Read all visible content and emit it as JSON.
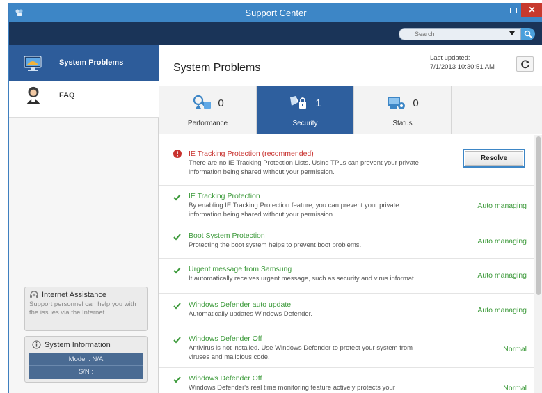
{
  "window": {
    "title": "Support Center"
  },
  "search": {
    "placeholder": "Search"
  },
  "sidebar": {
    "items": [
      {
        "label": "System Problems"
      },
      {
        "label": "FAQ"
      }
    ],
    "internet_assistance": {
      "title": "Internet Assistance",
      "description": "Support personnel can help you with the issues via the Internet."
    },
    "system_information": {
      "title": "System Information",
      "model": "Model : N/A",
      "sn": "S/N :"
    }
  },
  "main": {
    "title": "System Problems",
    "last_updated_label": "Last updated:",
    "last_updated_value": "7/1/2013 10:30:51 AM",
    "tabs": [
      {
        "label": "Performance",
        "count": "0"
      },
      {
        "label": "Security",
        "count": "1"
      },
      {
        "label": "Status",
        "count": "0"
      }
    ],
    "resolve_label": "Resolve",
    "items": [
      {
        "title": "IE Tracking Protection (recommended)",
        "desc": "There are no IE Tracking Protection Lists. Using TPLs can prevent your private information being shared without your permission.",
        "status": ""
      },
      {
        "title": "IE Tracking Protection",
        "desc": "By enabling IE Tracking Protection feature, you can prevent your private information being shared without your permission.",
        "status": "Auto managing"
      },
      {
        "title": "Boot System Protection",
        "desc": "Protecting the boot system helps to prevent boot problems.",
        "status": "Auto managing"
      },
      {
        "title": "Urgent message from Samsung",
        "desc": "It automatically receives urgent message, such as security and virus informat",
        "status": "Auto managing"
      },
      {
        "title": "Windows Defender auto update",
        "desc": "Automatically updates Windows Defender.",
        "status": "Auto managing"
      },
      {
        "title": "Windows Defender Off",
        "desc": "Antivirus is not installed. Use Windows Defender to protect your system from viruses and malicious code.",
        "status": "Normal"
      },
      {
        "title": "Windows Defender Off",
        "desc": "Windows Defender's real time monitoring feature actively protects your",
        "status": "Normal"
      }
    ]
  },
  "colors": {
    "titlebar": "#3d86c6",
    "accent_dark": "#2d5c9a",
    "warning": "#c8312e",
    "ok": "#3c9a3a"
  }
}
